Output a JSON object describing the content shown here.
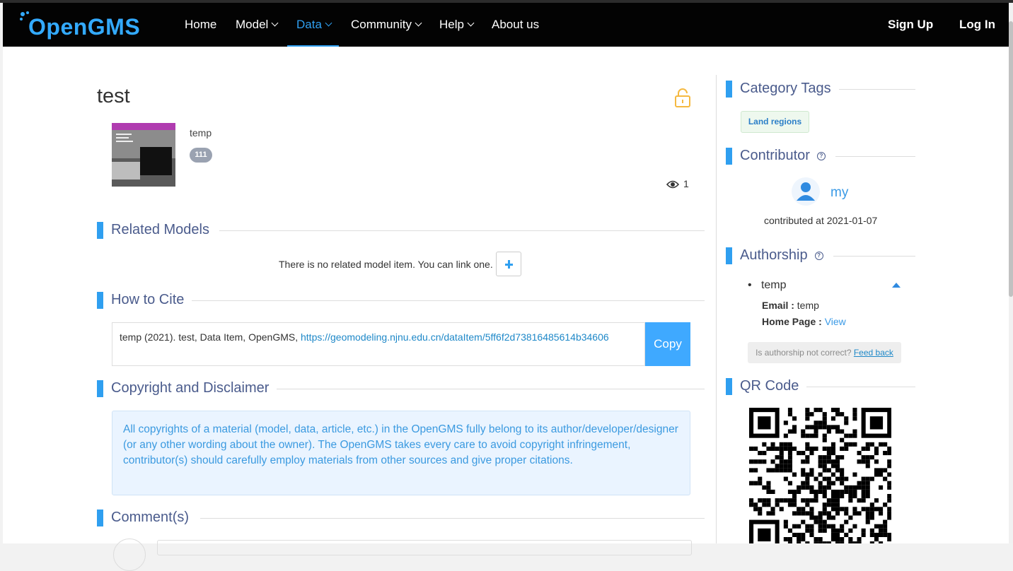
{
  "nav": {
    "brand": "OpenGMS",
    "items": [
      {
        "label": "Home",
        "dropdown": false,
        "active": false
      },
      {
        "label": "Model",
        "dropdown": true,
        "active": false
      },
      {
        "label": "Data",
        "dropdown": true,
        "active": true
      },
      {
        "label": "Community",
        "dropdown": true,
        "active": false
      },
      {
        "label": "Help",
        "dropdown": true,
        "active": false
      },
      {
        "label": "About us",
        "dropdown": false,
        "active": false
      }
    ],
    "sign_up": "Sign Up",
    "log_in": "Log In"
  },
  "item": {
    "title": "test",
    "author": "temp",
    "badge": "111",
    "views": "1"
  },
  "sections": {
    "related_models": "Related Models",
    "how_to_cite": "How to Cite",
    "copyright": "Copyright and Disclaimer",
    "comments": "Comment(s)"
  },
  "related": {
    "empty_text": "There is no related model item. You can link one."
  },
  "cite": {
    "text": "temp (2021). test, Data Item, OpenGMS, ",
    "link": "https://geomodeling.njnu.edu.cn/dataItem/5ff6f2d73816485614b34606",
    "copy_label": "Copy"
  },
  "disclaimer": "All copyrights of a material (model, data, article, etc.) in the OpenGMS fully belong to its author/developer/designer (or any other wording about the owner). The OpenGMS takes every care to avoid copyright infringement, contributor(s) should carefully employ materials from other sources and give proper citations.",
  "sidebar": {
    "category_tags": {
      "heading": "Category Tags",
      "tags": [
        "Land regions"
      ]
    },
    "contributor": {
      "heading": "Contributor",
      "name": "my",
      "date": "contributed at 2021-01-07"
    },
    "authorship": {
      "heading": "Authorship",
      "name": "temp",
      "email_label": "Email :",
      "email": "temp",
      "homepage_label": "Home Page :",
      "homepage_link": "View",
      "feedback_text": "Is authorship not correct?",
      "feedback_link": "Feed back"
    },
    "qr": {
      "heading": "QR Code"
    }
  },
  "colors": {
    "accent": "#2f9ff0",
    "navbar": "#030303",
    "heading": "#4a5b8c",
    "lock": "#f5b941"
  }
}
